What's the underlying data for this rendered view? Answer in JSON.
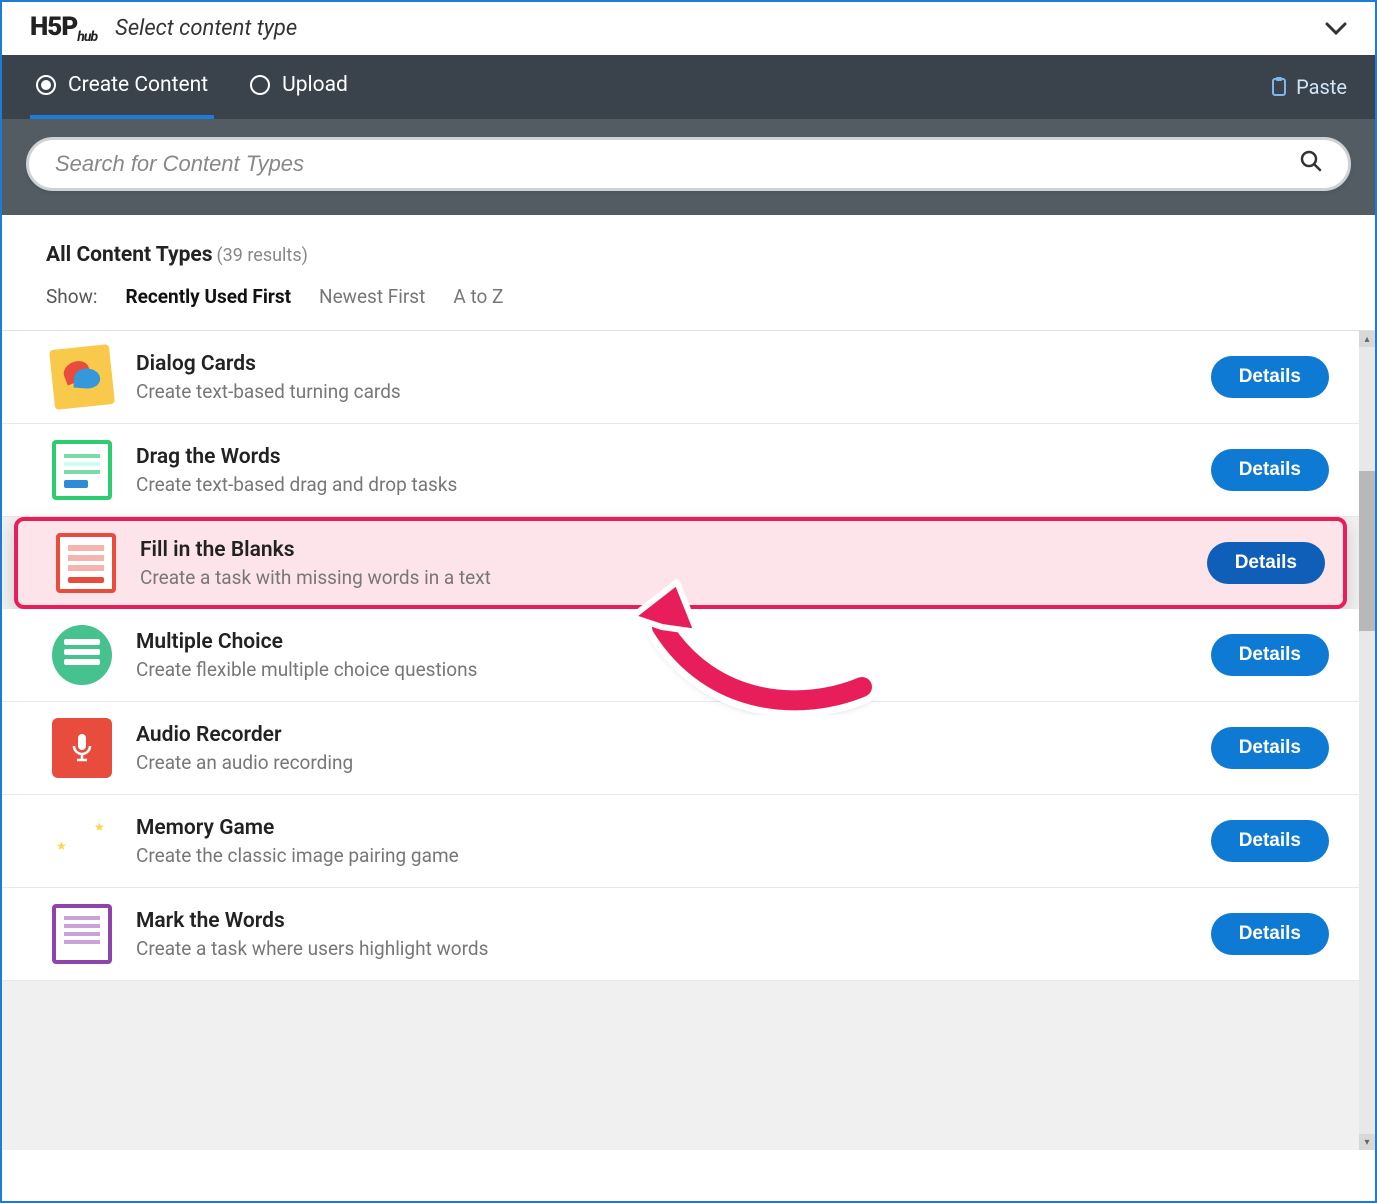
{
  "header": {
    "logo_main": "H5P",
    "logo_sub": "hub",
    "select_label": "Select content type"
  },
  "tabs": {
    "create": "Create Content",
    "upload": "Upload",
    "paste": "Paste"
  },
  "search": {
    "placeholder": "Search for Content Types"
  },
  "results": {
    "title": "All Content Types",
    "count_label": "(39 results)",
    "show_label": "Show:",
    "sort_recent": "Recently Used First",
    "sort_newest": "Newest First",
    "sort_az": "A to Z"
  },
  "details_label": "Details",
  "items": [
    {
      "title": "Dialog Cards",
      "desc": "Create text-based turning cards"
    },
    {
      "title": "Drag the Words",
      "desc": "Create text-based drag and drop tasks"
    },
    {
      "title": "Fill in the Blanks",
      "desc": "Create a task with missing words in a text"
    },
    {
      "title": "Multiple Choice",
      "desc": "Create flexible multiple choice questions"
    },
    {
      "title": "Audio Recorder",
      "desc": "Create an audio recording"
    },
    {
      "title": "Memory Game",
      "desc": "Create the classic image pairing game"
    },
    {
      "title": "Mark the Words",
      "desc": "Create a task where users highlight words"
    }
  ]
}
